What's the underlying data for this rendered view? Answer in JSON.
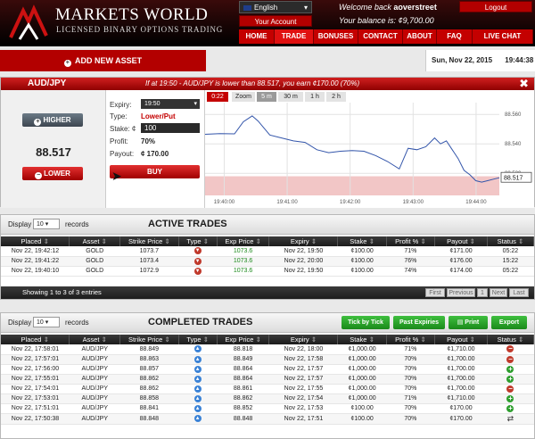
{
  "header": {
    "brand": "MARKETS WORLD",
    "tagline": "LICENSED BINARY OPTIONS TRADING",
    "language": "English",
    "your_account": "Your Account",
    "welcome_prefix": "Welcome back",
    "username": "aoverstreet",
    "balance_label": "Your balance is:",
    "balance": "¢9,700.00",
    "logout": "Logout",
    "nav": [
      "HOME",
      "TRADE",
      "BONUSES",
      "CONTACT",
      "ABOUT",
      "FAQ",
      "LIVE CHAT"
    ],
    "active_nav": "TRADE"
  },
  "toolbar": {
    "add_asset": "ADD NEW ASSET",
    "date": "Sun, Nov 22, 2015",
    "time": "19:44:38"
  },
  "trade_panel": {
    "asset": "AUD/JPY",
    "condition": "If at 19:50 - AUD/JPY is lower than 88.517, you earn ¢170.00 (70%)",
    "higher_label": "HIGHER",
    "lower_label": "LOWER",
    "current_price": "88.517",
    "expiry_label": "Expiry:",
    "expiry_value": "19:50",
    "type_label": "Type:",
    "type_value": "Lower/Put",
    "stake_label": "Stake: ¢",
    "stake_value": "100",
    "profit_label": "Profit:",
    "profit_value": "70%",
    "payout_label": "Payout:",
    "payout_value": "¢ 170.00",
    "buy_label": "BUY",
    "timer": "0:22",
    "zoom_label": "Zoom",
    "zoom_options": [
      "5 m",
      "30 m",
      "1 h",
      "2 h"
    ],
    "colors": {
      "accent": "#c40000",
      "line": "#3355aa",
      "zone": "#f2c6c6"
    }
  },
  "chart_data": {
    "type": "line",
    "x_ticks": [
      "19:40:00",
      "19:41:00",
      "19:42:00",
      "19:43:00",
      "19:44:00"
    ],
    "y_ticks": [
      "88.560",
      "88.540",
      "88.520"
    ],
    "ylim": [
      88.505,
      88.568
    ],
    "current_label": "88.517",
    "series": [
      {
        "x": [
          0.0,
          0.05,
          0.1,
          0.13,
          0.16,
          0.18,
          0.22,
          0.26,
          0.3,
          0.34,
          0.38,
          0.42,
          0.46,
          0.5,
          0.54,
          0.58,
          0.62,
          0.66,
          0.69,
          0.72,
          0.75,
          0.78,
          0.8,
          0.82,
          0.84,
          0.86,
          0.88,
          0.9,
          0.92,
          0.94,
          0.96,
          0.98,
          1.0
        ],
        "y": [
          88.5465,
          88.547,
          88.5468,
          88.555,
          88.559,
          88.5555,
          88.546,
          88.544,
          88.542,
          88.541,
          88.536,
          88.534,
          88.535,
          88.5355,
          88.535,
          88.532,
          88.528,
          88.523,
          88.537,
          88.536,
          88.538,
          88.544,
          88.54,
          88.542,
          88.536,
          88.53,
          88.522,
          88.519,
          88.515,
          88.514,
          88.515,
          88.516,
          88.517
        ]
      }
    ]
  },
  "active_trades": {
    "title": "ACTIVE TRADES",
    "display_label": "Display",
    "display_value": "10",
    "records_label": "records",
    "columns": [
      "Placed",
      "Asset",
      "Strike Price",
      "Type",
      "Exp Price",
      "Expiry",
      "Stake",
      "Profit %",
      "Payout",
      "Status"
    ],
    "rows": [
      [
        "Nov 22, 19:42:12",
        "GOLD",
        "1073.7",
        "down",
        "1073.6",
        "Nov 22, 19:50",
        "¢100.00",
        "71%",
        "¢171.00",
        "05:22"
      ],
      [
        "Nov 22, 19:41:22",
        "GOLD",
        "1073.4",
        "down",
        "1073.6",
        "Nov 22, 20:00",
        "¢100.00",
        "76%",
        "¢176.00",
        "15:22"
      ],
      [
        "Nov 22, 19:40:10",
        "GOLD",
        "1072.9",
        "down",
        "1073.6",
        "Nov 22, 19:50",
        "¢100.00",
        "74%",
        "¢174.00",
        "05:22"
      ]
    ],
    "footer_info": "Showing 1 to 3 of 3 entries",
    "pager": [
      "First",
      "Previous",
      "1",
      "Next",
      "Last"
    ]
  },
  "completed_trades": {
    "title": "COMPLETED TRADES",
    "display_label": "Display",
    "display_value": "10",
    "records_label": "records",
    "buttons": [
      "Tick by Tick",
      "Past Expiries",
      "Print",
      "Export"
    ],
    "columns": [
      "Placed",
      "Asset",
      "Strike Price",
      "Type",
      "Exp Price",
      "Expiry",
      "Stake",
      "Profit %",
      "Payout",
      "Status"
    ],
    "rows": [
      [
        "Nov 22, 17:58:01",
        "AUD/JPY",
        "88.849",
        "up",
        "88.818",
        "Nov 22, 18:00",
        "¢1,000.00",
        "71%",
        "¢1,710.00",
        "minus"
      ],
      [
        "Nov 22, 17:57:01",
        "AUD/JPY",
        "88.863",
        "up",
        "88.849",
        "Nov 22, 17:58",
        "¢1,000.00",
        "70%",
        "¢1,700.00",
        "minus"
      ],
      [
        "Nov 22, 17:56:00",
        "AUD/JPY",
        "88.857",
        "up",
        "88.864",
        "Nov 22, 17:57",
        "¢1,000.00",
        "70%",
        "¢1,700.00",
        "plus"
      ],
      [
        "Nov 22, 17:55:01",
        "AUD/JPY",
        "88.862",
        "up",
        "88.864",
        "Nov 22, 17:57",
        "¢1,000.00",
        "70%",
        "¢1,700.00",
        "plus"
      ],
      [
        "Nov 22, 17:54:01",
        "AUD/JPY",
        "88.862",
        "up",
        "88.861",
        "Nov 22, 17:55",
        "¢1,000.00",
        "70%",
        "¢1,700.00",
        "minus"
      ],
      [
        "Nov 22, 17:53:01",
        "AUD/JPY",
        "88.858",
        "up",
        "88.862",
        "Nov 22, 17:54",
        "¢1,000.00",
        "71%",
        "¢1,710.00",
        "plus"
      ],
      [
        "Nov 22, 17:51:01",
        "AUD/JPY",
        "88.841",
        "up",
        "88.852",
        "Nov 22, 17:53",
        "¢100.00",
        "70%",
        "¢170.00",
        "plus"
      ],
      [
        "Nov 22, 17:50:38",
        "AUD/JPY",
        "88.848",
        "up",
        "88.848",
        "Nov 22, 17:51",
        "¢100.00",
        "70%",
        "¢170.00",
        "equal"
      ]
    ]
  }
}
